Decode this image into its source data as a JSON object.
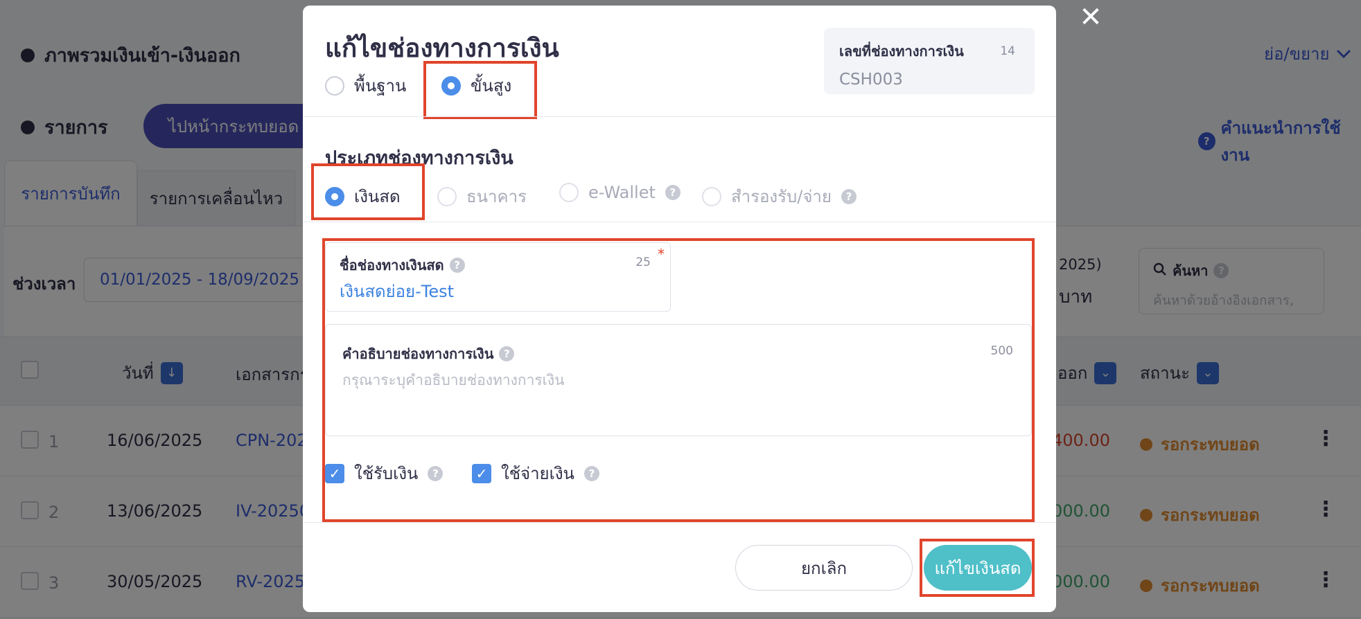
{
  "background": {
    "overview_title": "ภาพรวมเงินเข้า-เงินออก",
    "collapse_label": "ย่อ/ขยาย",
    "list_title": "รายการ",
    "goto_reconcile_label": "ไปหน้ากระทบยอด",
    "help_label": "คำแนะนำการใช้งาน",
    "tabs": [
      {
        "label": "รายการบันทึก",
        "active": true
      },
      {
        "label": "รายการเคลื่อนไหว",
        "active": false
      }
    ],
    "date_range_label": "ช่วงเวลา",
    "date_range_value": "01/01/2025 - 18/09/2025",
    "summary_fragment_1": "2025)",
    "summary_fragment_2": "บาท",
    "search": {
      "title": "ค้นหา",
      "placeholder": "ค้นหาด้วยอ้างอิงเอกสาร,"
    },
    "table": {
      "headers": {
        "date": "วันที่",
        "document": "เอกสารกร",
        "amount_out": "ออก",
        "status": "สถานะ"
      },
      "rows": [
        {
          "no": "1",
          "date": "16/06/2025",
          "document": "CPN-202",
          "amount": "400.00",
          "amount_type": "out",
          "status": "รอกระทบยอด"
        },
        {
          "no": "2",
          "date": "13/06/2025",
          "document": "IV-20250",
          "amount": "000.00",
          "amount_type": "in",
          "status": "รอกระทบยอด"
        },
        {
          "no": "3",
          "date": "30/05/2025",
          "document": "RV-2025",
          "amount": "000.00",
          "amount_type": "in",
          "status": "รอกระทบยอด"
        }
      ]
    }
  },
  "modal": {
    "title": "แก้ไขช่องทางการเงิน",
    "mode_options": [
      {
        "label": "พื้นฐาน",
        "selected": false
      },
      {
        "label": "ขั้นสูง",
        "selected": true
      }
    ],
    "channel_id": {
      "label": "เลขที่ช่องทางการเงิน",
      "char_limit": "14",
      "value": "CSH003"
    },
    "type_section_title": "ประเภทช่องทางการเงิน",
    "type_options": [
      {
        "label": "เงินสด",
        "selected": true,
        "disabled": false,
        "help": false
      },
      {
        "label": "ธนาคาร",
        "selected": false,
        "disabled": true,
        "help": false
      },
      {
        "label": "e-Wallet",
        "selected": false,
        "disabled": true,
        "help": true
      },
      {
        "label": "สำรองรับ/จ่าย",
        "selected": false,
        "disabled": true,
        "help": true
      }
    ],
    "name_field": {
      "label": "ชื่อช่องทางเงินสด",
      "char_limit": "25",
      "required_mark": "*",
      "value": "เงินสดย่อย-Test"
    },
    "description_field": {
      "label": "คำอธิบายช่องทางการเงิน",
      "char_limit": "500",
      "placeholder": "กรุณาระบุคำอธิบายช่องทางการเงิน"
    },
    "checkboxes": [
      {
        "label": "ใช้รับเงิน",
        "checked": true
      },
      {
        "label": "ใช้จ่ายเงิน",
        "checked": true
      }
    ],
    "cancel_label": "ยกเลิก",
    "submit_label": "แก้ไขเงินสด",
    "close_icon": "close-icon"
  },
  "colors": {
    "accent": "#4b8de8",
    "submit": "#4fbfc8",
    "highlight": "#e0452b",
    "pending": "#e08a2f"
  }
}
